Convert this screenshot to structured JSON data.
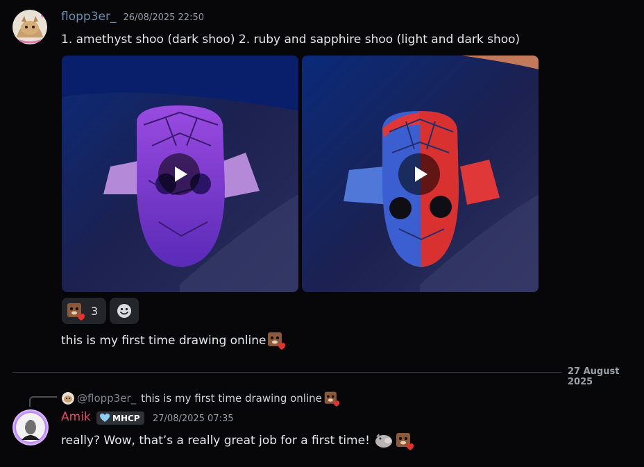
{
  "message1": {
    "author": "flopp3er_",
    "timestamp": "26/08/2025 22:50",
    "content": "1. amethyst shoo (dark shoo) 2. ruby and sapphire shoo (light and dark shoo)",
    "reactions": [
      {
        "emoji_icon": "puppy-heart-emoji-icon",
        "count": "3"
      }
    ],
    "add_reaction_icon": "smiley-add-reaction-icon"
  },
  "message2": {
    "content": "this is my first time drawing online"
  },
  "date_divider": "27 August 2025",
  "reply": {
    "mention": "@flopp3er_",
    "quoted_text": "this is my first time drawing online"
  },
  "message3": {
    "author": "Amik",
    "badge": "MHCP",
    "timestamp": "27/08/2025 07:35",
    "content": "really? Wow, that’s a really great job for a first time!"
  },
  "colors": {
    "background": "#070709",
    "author_default": "#6c8faf",
    "author_amik": "#e8456b",
    "timestamp": "#949ba4",
    "divider": "#3a3c42"
  }
}
